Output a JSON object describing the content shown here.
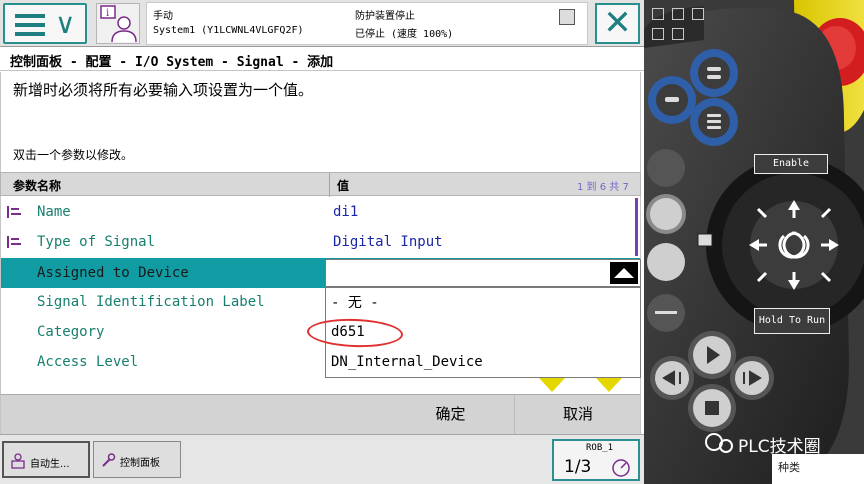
{
  "status": {
    "mode": "手动",
    "system": "System1 (Y1LCWNL4VLGFQ2F)",
    "guard": "防护装置停止",
    "state": "已停止 (速度 100%)"
  },
  "breadcrumb": "控制面板 - 配置 - I/O System - Signal - 添加",
  "instruction": "新增时必须将所有必要输入项设置为一个值。",
  "hint": "双击一个参数以修改。",
  "table": {
    "col_name": "参数名称",
    "col_value": "值",
    "range": "1 到 6 共 7",
    "rows": [
      {
        "name": "Name",
        "value": "di1"
      },
      {
        "name": "Type of Signal",
        "value": "Digital Input"
      },
      {
        "name": "Assigned to Device",
        "value": ""
      },
      {
        "name": "Signal Identification Label",
        "value": ""
      },
      {
        "name": "Category",
        "value": ""
      },
      {
        "name": "Access Level",
        "value": ""
      }
    ]
  },
  "dropdown": {
    "current": "",
    "options": [
      "- 无 -",
      "d651",
      "DN_Internal_Device"
    ]
  },
  "actions": {
    "ok": "确定",
    "cancel": "取消"
  },
  "taskbar": {
    "auto": "自动生...",
    "panel": "控制面板",
    "rob_label": "ROB_1",
    "rob_fraction": "1/3"
  },
  "pendant": {
    "enable": "Enable",
    "hold": "Hold To Run",
    "watermark": "PLC技术圈",
    "footer": "种类"
  },
  "colors": {
    "selected_row": "#119ca3",
    "accent_teal": "#1f7f80",
    "name_text": "#17806f",
    "value_text": "#1a27a8",
    "annotation": "#e03030"
  }
}
